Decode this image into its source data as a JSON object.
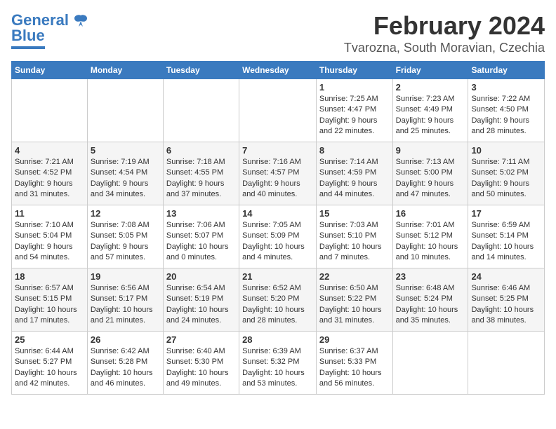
{
  "logo": {
    "general": "General",
    "blue": "Blue"
  },
  "title": "February 2024",
  "subtitle": "Tvarozna, South Moravian, Czechia",
  "headers": [
    "Sunday",
    "Monday",
    "Tuesday",
    "Wednesday",
    "Thursday",
    "Friday",
    "Saturday"
  ],
  "weeks": [
    [
      {
        "day": "",
        "info": ""
      },
      {
        "day": "",
        "info": ""
      },
      {
        "day": "",
        "info": ""
      },
      {
        "day": "",
        "info": ""
      },
      {
        "day": "1",
        "info": "Sunrise: 7:25 AM\nSunset: 4:47 PM\nDaylight: 9 hours\nand 22 minutes."
      },
      {
        "day": "2",
        "info": "Sunrise: 7:23 AM\nSunset: 4:49 PM\nDaylight: 9 hours\nand 25 minutes."
      },
      {
        "day": "3",
        "info": "Sunrise: 7:22 AM\nSunset: 4:50 PM\nDaylight: 9 hours\nand 28 minutes."
      }
    ],
    [
      {
        "day": "4",
        "info": "Sunrise: 7:21 AM\nSunset: 4:52 PM\nDaylight: 9 hours\nand 31 minutes."
      },
      {
        "day": "5",
        "info": "Sunrise: 7:19 AM\nSunset: 4:54 PM\nDaylight: 9 hours\nand 34 minutes."
      },
      {
        "day": "6",
        "info": "Sunrise: 7:18 AM\nSunset: 4:55 PM\nDaylight: 9 hours\nand 37 minutes."
      },
      {
        "day": "7",
        "info": "Sunrise: 7:16 AM\nSunset: 4:57 PM\nDaylight: 9 hours\nand 40 minutes."
      },
      {
        "day": "8",
        "info": "Sunrise: 7:14 AM\nSunset: 4:59 PM\nDaylight: 9 hours\nand 44 minutes."
      },
      {
        "day": "9",
        "info": "Sunrise: 7:13 AM\nSunset: 5:00 PM\nDaylight: 9 hours\nand 47 minutes."
      },
      {
        "day": "10",
        "info": "Sunrise: 7:11 AM\nSunset: 5:02 PM\nDaylight: 9 hours\nand 50 minutes."
      }
    ],
    [
      {
        "day": "11",
        "info": "Sunrise: 7:10 AM\nSunset: 5:04 PM\nDaylight: 9 hours\nand 54 minutes."
      },
      {
        "day": "12",
        "info": "Sunrise: 7:08 AM\nSunset: 5:05 PM\nDaylight: 9 hours\nand 57 minutes."
      },
      {
        "day": "13",
        "info": "Sunrise: 7:06 AM\nSunset: 5:07 PM\nDaylight: 10 hours\nand 0 minutes."
      },
      {
        "day": "14",
        "info": "Sunrise: 7:05 AM\nSunset: 5:09 PM\nDaylight: 10 hours\nand 4 minutes."
      },
      {
        "day": "15",
        "info": "Sunrise: 7:03 AM\nSunset: 5:10 PM\nDaylight: 10 hours\nand 7 minutes."
      },
      {
        "day": "16",
        "info": "Sunrise: 7:01 AM\nSunset: 5:12 PM\nDaylight: 10 hours\nand 10 minutes."
      },
      {
        "day": "17",
        "info": "Sunrise: 6:59 AM\nSunset: 5:14 PM\nDaylight: 10 hours\nand 14 minutes."
      }
    ],
    [
      {
        "day": "18",
        "info": "Sunrise: 6:57 AM\nSunset: 5:15 PM\nDaylight: 10 hours\nand 17 minutes."
      },
      {
        "day": "19",
        "info": "Sunrise: 6:56 AM\nSunset: 5:17 PM\nDaylight: 10 hours\nand 21 minutes."
      },
      {
        "day": "20",
        "info": "Sunrise: 6:54 AM\nSunset: 5:19 PM\nDaylight: 10 hours\nand 24 minutes."
      },
      {
        "day": "21",
        "info": "Sunrise: 6:52 AM\nSunset: 5:20 PM\nDaylight: 10 hours\nand 28 minutes."
      },
      {
        "day": "22",
        "info": "Sunrise: 6:50 AM\nSunset: 5:22 PM\nDaylight: 10 hours\nand 31 minutes."
      },
      {
        "day": "23",
        "info": "Sunrise: 6:48 AM\nSunset: 5:24 PM\nDaylight: 10 hours\nand 35 minutes."
      },
      {
        "day": "24",
        "info": "Sunrise: 6:46 AM\nSunset: 5:25 PM\nDaylight: 10 hours\nand 38 minutes."
      }
    ],
    [
      {
        "day": "25",
        "info": "Sunrise: 6:44 AM\nSunset: 5:27 PM\nDaylight: 10 hours\nand 42 minutes."
      },
      {
        "day": "26",
        "info": "Sunrise: 6:42 AM\nSunset: 5:28 PM\nDaylight: 10 hours\nand 46 minutes."
      },
      {
        "day": "27",
        "info": "Sunrise: 6:40 AM\nSunset: 5:30 PM\nDaylight: 10 hours\nand 49 minutes."
      },
      {
        "day": "28",
        "info": "Sunrise: 6:39 AM\nSunset: 5:32 PM\nDaylight: 10 hours\nand 53 minutes."
      },
      {
        "day": "29",
        "info": "Sunrise: 6:37 AM\nSunset: 5:33 PM\nDaylight: 10 hours\nand 56 minutes."
      },
      {
        "day": "",
        "info": ""
      },
      {
        "day": "",
        "info": ""
      }
    ]
  ]
}
